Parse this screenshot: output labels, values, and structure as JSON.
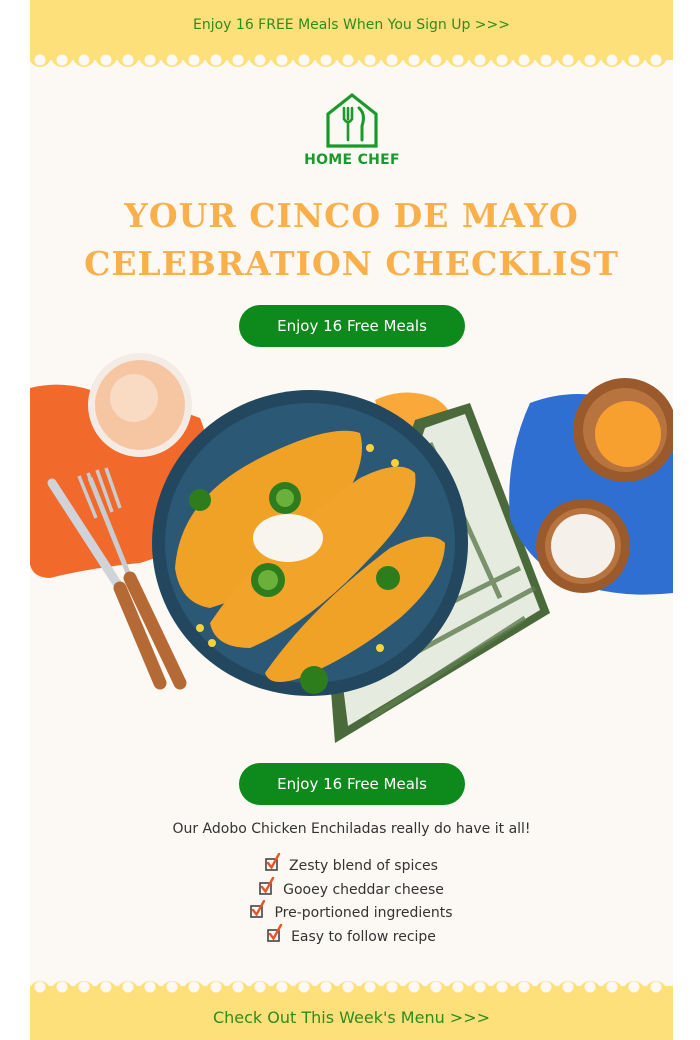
{
  "top_banner": {
    "link_text": "Enjoy 16 FREE Meals When You Sign Up >>>"
  },
  "logo": {
    "text": "HOME CHEF",
    "icon": "house-fork-knife-icon"
  },
  "headline": {
    "line1": "YOUR CINCO DE MAYO",
    "line2": "CELEBRATION CHECKLIST"
  },
  "cta_primary": {
    "label": "Enjoy 16 Free Meals"
  },
  "hero": {
    "description_icon": "enchilada-plate-image"
  },
  "cta_secondary": {
    "label": "Enjoy 16 Free Meals"
  },
  "intro": {
    "text": "Our Adobo Chicken Enchiladas really do have it all!"
  },
  "checklist": {
    "items": [
      {
        "label": "Zesty blend of spices",
        "icon": "checkbox-checked-icon"
      },
      {
        "label": "Gooey cheddar cheese",
        "icon": "checkbox-checked-icon"
      },
      {
        "label": "Pre-portioned ingredients",
        "icon": "checkbox-checked-icon"
      },
      {
        "label": "Easy to follow recipe",
        "icon": "checkbox-checked-icon"
      }
    ]
  },
  "footer": {
    "link_text": "Check Out This Week's Menu >>>"
  },
  "colors": {
    "banner_yellow": "#fde07a",
    "brand_green": "#0e8a1c",
    "link_green": "#2e8b1e",
    "headline_orange": "#f9b04a",
    "background": "#fcf9f4"
  }
}
